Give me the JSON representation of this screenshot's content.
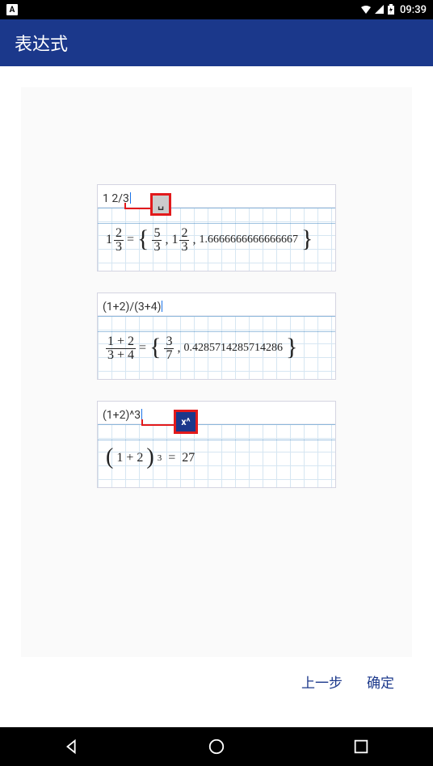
{
  "status": {
    "time": "09:39"
  },
  "title": "表达式",
  "examples": [
    {
      "input": "1 2/3",
      "key_label": "␣",
      "key_style": "gray",
      "result_decimal": "1.6666666666666667",
      "mixed_n": "1",
      "mixed_num": "2",
      "mixed_den": "3",
      "frac_num": "5",
      "frac_den": "3"
    },
    {
      "input": "(1+2)/(3+4)",
      "result_decimal": "0.4285714285714286",
      "left_top": "1 + 2",
      "left_bot": "3 + 4",
      "frac_num": "3",
      "frac_den": "7"
    },
    {
      "input": "(1+2)^3",
      "key_label": "x^",
      "key_style": "blue",
      "base": "1 + 2",
      "exp": "3",
      "value": "27"
    }
  ],
  "buttons": {
    "prev": "上一步",
    "ok": "确定"
  }
}
